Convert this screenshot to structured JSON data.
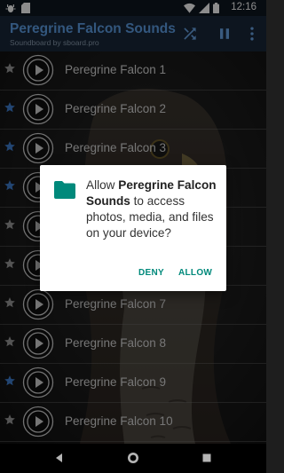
{
  "status_bar": {
    "time": "12:16",
    "icons": [
      "debug-icon",
      "sd-card-icon",
      "wifi-icon",
      "signal-icon",
      "battery-icon"
    ]
  },
  "app_bar": {
    "title": "Peregrine Falcon Sounds",
    "subtitle": "Soundboard by sboard.pro",
    "actions": [
      "shuffle-icon",
      "pause-icon",
      "more-vert-icon"
    ]
  },
  "sounds": [
    {
      "label": "Peregrine Falcon 1",
      "favorite": false
    },
    {
      "label": "Peregrine Falcon 2",
      "favorite": true
    },
    {
      "label": "Peregrine Falcon 3",
      "favorite": true
    },
    {
      "label": "Peregrine Falcon 4",
      "favorite": true
    },
    {
      "label": "Peregrine Falcon 5",
      "favorite": false
    },
    {
      "label": "Peregrine Falcon 6",
      "favorite": false
    },
    {
      "label": "Peregrine Falcon 7",
      "favorite": false
    },
    {
      "label": "Peregrine Falcon 8",
      "favorite": false
    },
    {
      "label": "Peregrine Falcon 9",
      "favorite": true
    },
    {
      "label": "Peregrine Falcon 10",
      "favorite": false
    }
  ],
  "permission_dialog": {
    "prefix": "Allow ",
    "app_name": "Peregrine Falcon Sounds",
    "suffix": " to access photos, media, and files on your device?",
    "deny_label": "DENY",
    "allow_label": "ALLOW",
    "icon": "folder-icon"
  },
  "navigation_bar": {
    "icons": [
      "back-icon",
      "home-icon",
      "recents-icon"
    ]
  },
  "colors": {
    "app_bar_bg": "#18273a",
    "title": "#5d9fe6",
    "favorite_star": "#3f7fd0",
    "plain_star": "#9a9a9a",
    "dialog_accent": "#00897b"
  }
}
